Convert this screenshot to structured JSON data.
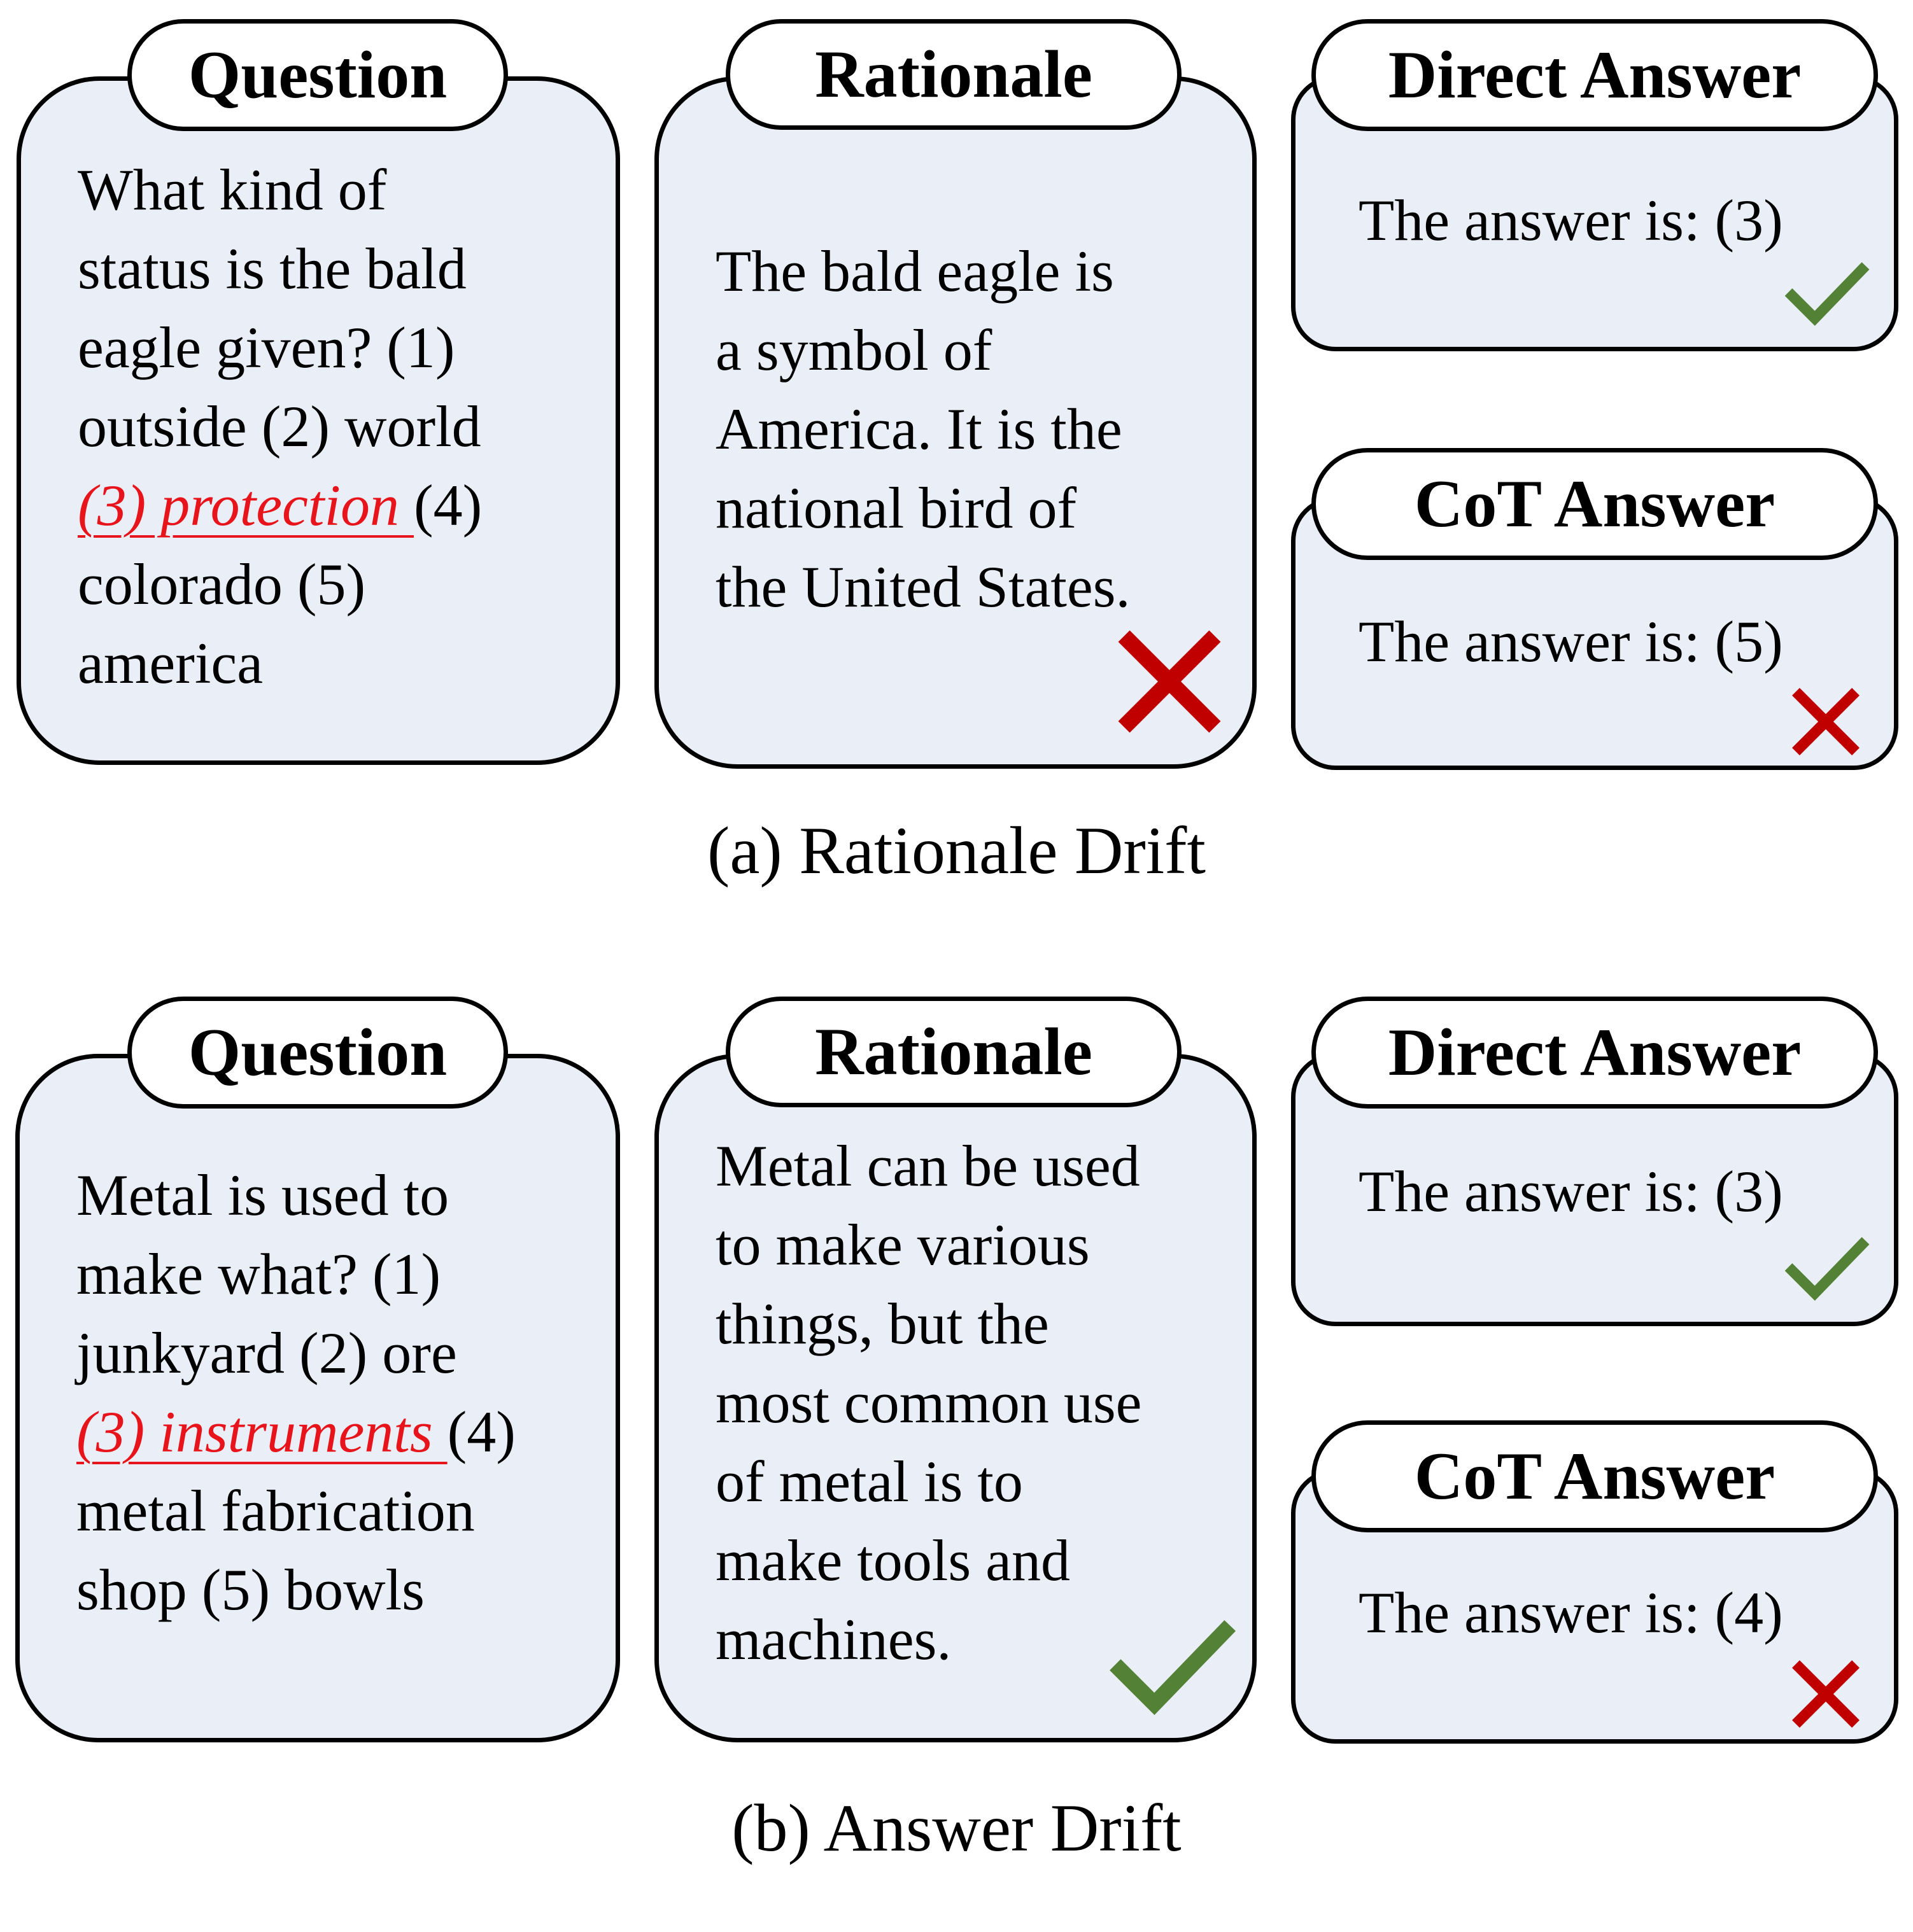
{
  "colors": {
    "card_fill": "#e9eef7",
    "outline": "#000000",
    "highlight_red": "#e8141b",
    "cross_red": "#c00000",
    "check_green": "#538135"
  },
  "panels": [
    {
      "caption": "(a) Rationale Drift",
      "question": {
        "label": "Question",
        "lines": [
          "What kind of",
          "status is the bald",
          "eagle given? (1)",
          "outside (2) world",
          "",
          "colorado (5)",
          "america"
        ],
        "highlight": "(3) protection ",
        "after_highlight": "(4)"
      },
      "rationale": {
        "label": "Rationale",
        "lines": [
          "The bald eagle is",
          "a symbol of",
          "America. It is the",
          "national bird of",
          "the United States."
        ],
        "verdict": "incorrect",
        "verdict_icon": "cross-icon"
      },
      "direct_answer": {
        "label": "Direct Answer",
        "text": "The answer is: (3)",
        "verdict": "correct",
        "verdict_icon": "check-icon"
      },
      "cot_answer": {
        "label": "CoT Answer",
        "text": "The answer is: (5)",
        "verdict": "incorrect",
        "verdict_icon": "cross-icon"
      }
    },
    {
      "caption": "(b) Answer Drift",
      "question": {
        "label": "Question",
        "lines": [
          "Metal is used to",
          "make what? (1)",
          "junkyard (2) ore",
          "",
          "metal fabrication",
          "shop (5) bowls"
        ],
        "highlight": "(3) instruments ",
        "after_highlight": "(4)"
      },
      "rationale": {
        "label": "Rationale",
        "lines": [
          "Metal can be used",
          "to make various",
          "things, but the",
          "most common use",
          "of metal is to",
          "make tools and",
          "machines."
        ],
        "verdict": "correct",
        "verdict_icon": "check-icon"
      },
      "direct_answer": {
        "label": "Direct Answer",
        "text": "The answer is: (3)",
        "verdict": "correct",
        "verdict_icon": "check-icon"
      },
      "cot_answer": {
        "label": "CoT Answer",
        "text": "The answer is: (4)",
        "verdict": "incorrect",
        "verdict_icon": "cross-icon"
      }
    }
  ]
}
